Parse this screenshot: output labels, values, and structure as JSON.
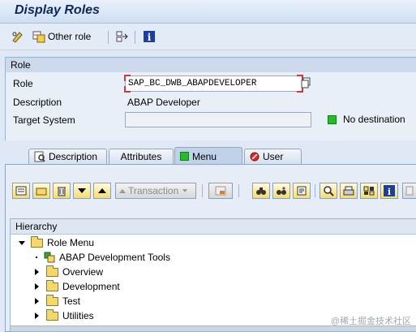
{
  "window": {
    "title": "Display Roles"
  },
  "toolbar": {
    "other_role_label": "Other role"
  },
  "role_section": {
    "header": "Role",
    "role_label": "Role",
    "role_value": "SAP_BC_DWB_ABAPDEVELOPER",
    "description_label": "Description",
    "description_value": "ABAP Developer",
    "target_label": "Target System",
    "target_value": "",
    "destination_status": "No destination",
    "destination_status_color": "#1fbf2a"
  },
  "tabs": [
    {
      "label": "Description",
      "icon": "description-icon"
    },
    {
      "label": "Attributes",
      "icon": ""
    },
    {
      "label": "Menu",
      "icon": "status-green-icon",
      "active": true
    },
    {
      "label": "User",
      "icon": "status-red-icon"
    }
  ],
  "menu_toolbar": {
    "transaction_label": "Transaction"
  },
  "hierarchy": {
    "header": "Hierarchy",
    "root": "Role Menu",
    "items": [
      {
        "label": "ABAP Development Tools",
        "icon": "application-icon",
        "expandable": false
      },
      {
        "label": "Overview",
        "icon": "folder-icon",
        "expandable": true
      },
      {
        "label": "Development",
        "icon": "folder-icon",
        "expandable": true
      },
      {
        "label": "Test",
        "icon": "folder-icon",
        "expandable": true
      },
      {
        "label": "Utilities",
        "icon": "folder-icon",
        "expandable": true
      }
    ]
  },
  "watermark": "@稀土掘金技术社区"
}
